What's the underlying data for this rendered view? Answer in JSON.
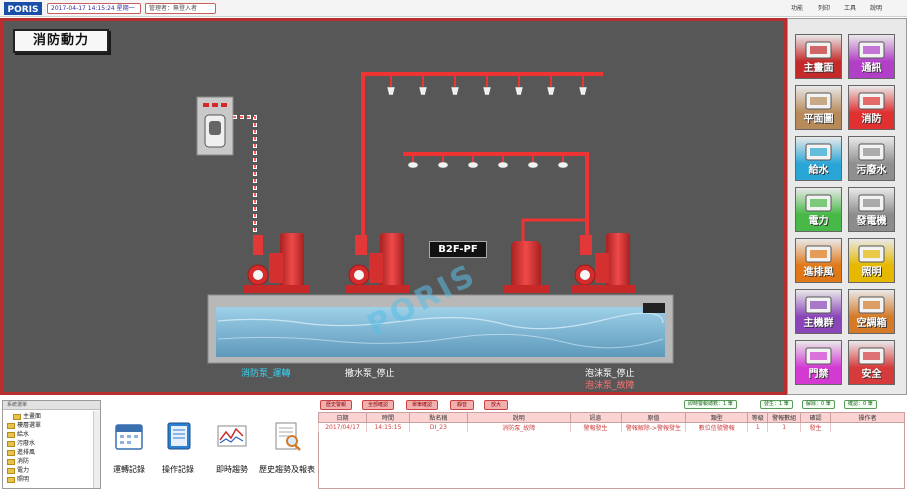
{
  "header": {
    "datetime": "2017-04-17 14:15:24 星期一",
    "user": "管理者：無登入者",
    "menu": [
      "功能",
      "列印",
      "工具",
      "說明"
    ]
  },
  "scada": {
    "title": "消防動力",
    "label": "B2F-PF",
    "watermark": "PORIS",
    "status": [
      {
        "text": "消防泵_運轉",
        "color": "#39d4f5"
      },
      {
        "text": "撒水泵_停止",
        "color": "#ffffff"
      },
      {
        "text": "泡沫泵_停止",
        "color": "#ffffff"
      },
      {
        "text": "泡沫泵_故障",
        "color": "#ff6f6f"
      }
    ]
  },
  "nav": [
    {
      "label": "主畫面",
      "color": "#c42a2a",
      "icon": "main-screen-icon"
    },
    {
      "label": "通訊",
      "color": "#b13fc8",
      "icon": "communication-icon"
    },
    {
      "label": "平面圖",
      "color": "#b78a5a",
      "icon": "floor-plan-icon"
    },
    {
      "label": "消防",
      "color": "#e03030",
      "icon": "fire-hydrant-icon"
    },
    {
      "label": "給水",
      "color": "#2aa6d6",
      "icon": "water-supply-icon"
    },
    {
      "label": "污廢水",
      "color": "#8f8f8f",
      "icon": "sewage-icon"
    },
    {
      "label": "電力",
      "color": "#48b848",
      "icon": "power-icon"
    },
    {
      "label": "發電機",
      "color": "#8c8c8c",
      "icon": "generator-icon"
    },
    {
      "label": "進排風",
      "color": "#e07818",
      "icon": "ventilation-icon"
    },
    {
      "label": "照明",
      "color": "#e6b800",
      "icon": "lighting-icon"
    },
    {
      "label": "主機群",
      "color": "#8a46b8",
      "icon": "chiller-icon"
    },
    {
      "label": "空調箱",
      "color": "#d47a28",
      "icon": "ahu-icon"
    },
    {
      "label": "門禁",
      "color": "#d23ad2",
      "icon": "access-control-icon"
    },
    {
      "label": "安全",
      "color": "#d63a3a",
      "icon": "security-icon"
    }
  ],
  "tree": {
    "header": "系統選單",
    "items": [
      "主畫面",
      "樓層選單",
      "給水",
      "污廢水",
      "進排風",
      "消防",
      "電力",
      "照明"
    ]
  },
  "tools": [
    "運轉記錄",
    "操作記錄",
    "即時趨勢",
    "歷史趨勢及報表"
  ],
  "alarm": {
    "buttons": [
      "歷史警報",
      "全部確認",
      "單筆確認",
      "靜音",
      "放大"
    ],
    "counts": [
      "即時警報總數：1 筆",
      "發生：1 筆",
      "解除：0 筆",
      "確認：0 筆"
    ],
    "columns": [
      "日期",
      "時間",
      "點名稱",
      "說明",
      "訊息",
      "原值",
      "類型",
      "等級",
      "警報數組",
      "確認",
      "操作者"
    ],
    "rows": [
      [
        "2017/04/17",
        "14:15:15",
        "DI_23",
        "消防泵_故障",
        "警報發生",
        "警報解除->警報發生",
        "數位信號警報",
        "1",
        "1",
        "發生",
        ""
      ]
    ]
  }
}
